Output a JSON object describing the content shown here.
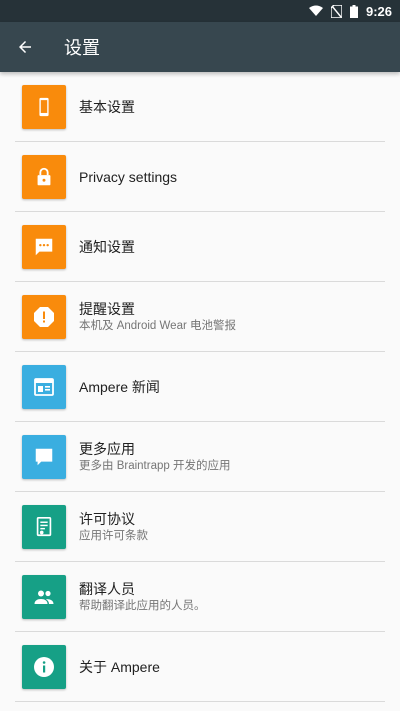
{
  "status_bar": {
    "time": "9:26",
    "icons": [
      "wifi-icon",
      "no-sim-icon",
      "battery-icon"
    ]
  },
  "toolbar": {
    "title": "设置",
    "back_icon": "arrow-back-icon"
  },
  "colors": {
    "orange": "#f98b0c",
    "blue": "#3aaee0",
    "teal": "#16a086",
    "toolbar": "#37474f",
    "status_bar": "#263238"
  },
  "items": [
    {
      "label": "基本设置",
      "subtitle": "",
      "icon": "phone-icon",
      "color": "orange"
    },
    {
      "label": "Privacy settings",
      "subtitle": "",
      "icon": "lock-icon",
      "color": "orange"
    },
    {
      "label": "通知设置",
      "subtitle": "",
      "icon": "message-icon",
      "color": "orange"
    },
    {
      "label": "提醒设置",
      "subtitle": "本机及 Android Wear 电池警报",
      "icon": "alert-icon",
      "color": "orange"
    },
    {
      "label": "Ampere 新闻",
      "subtitle": "",
      "icon": "news-icon",
      "color": "blue"
    },
    {
      "label": "更多应用",
      "subtitle": "更多由 Braintrapp 开发的应用",
      "icon": "chat-bubble-icon",
      "color": "blue"
    },
    {
      "label": "许可协议",
      "subtitle": "应用许可条款",
      "icon": "license-icon",
      "color": "teal"
    },
    {
      "label": "翻译人员",
      "subtitle": "帮助翻译此应用的人员。",
      "icon": "people-icon",
      "color": "teal"
    },
    {
      "label": "关于 Ampere",
      "subtitle": "",
      "icon": "info-icon",
      "color": "teal"
    }
  ]
}
